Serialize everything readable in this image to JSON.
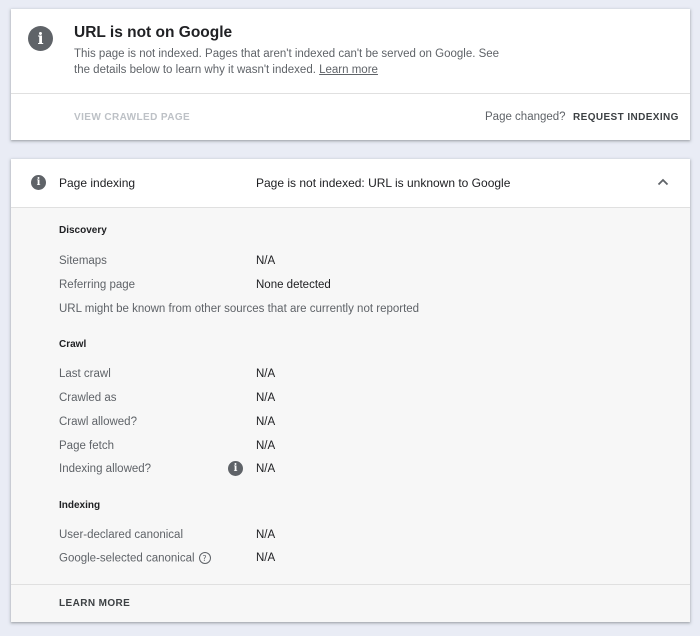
{
  "status_card": {
    "icon": "info-icon",
    "title": "URL is not on Google",
    "description": "This page is not indexed. Pages that aren't indexed can't be served on Google. See the details below to learn why it wasn't indexed.",
    "learn_more_link": "Learn more",
    "view_crawled_page": "VIEW CRAWLED PAGE",
    "page_changed": "Page changed?",
    "request_indexing": "REQUEST INDEXING"
  },
  "details_card": {
    "header_icon": "info-icon",
    "header_label": "Page indexing",
    "header_value": "Page is not indexed: URL is unknown to Google",
    "collapse_icon": "chevron-up-icon",
    "discovery": {
      "title": "Discovery",
      "sitemaps_label": "Sitemaps",
      "sitemaps_value": "N/A",
      "referring_label": "Referring page",
      "referring_value": "None detected",
      "note": "URL might be known from other sources that are currently not reported"
    },
    "crawl": {
      "title": "Crawl",
      "last_crawl_label": "Last crawl",
      "last_crawl_value": "N/A",
      "crawled_as_label": "Crawled as",
      "crawled_as_value": "N/A",
      "crawl_allowed_label": "Crawl allowed?",
      "crawl_allowed_value": "N/A",
      "page_fetch_label": "Page fetch",
      "page_fetch_value": "N/A",
      "indexing_allowed_label": "Indexing allowed?",
      "indexing_allowed_value": "N/A"
    },
    "indexing": {
      "title": "Indexing",
      "user_canonical_label": "User-declared canonical",
      "user_canonical_value": "N/A",
      "google_canonical_label": "Google-selected canonical",
      "google_canonical_value": "N/A"
    },
    "learn_more": "LEARN MORE"
  },
  "colors": {
    "background": "#e9ecf5",
    "card": "#ffffff",
    "details_body": "#f7f7f7",
    "icon_gray": "#5f6368",
    "disabled_text": "#bdc1c6"
  }
}
